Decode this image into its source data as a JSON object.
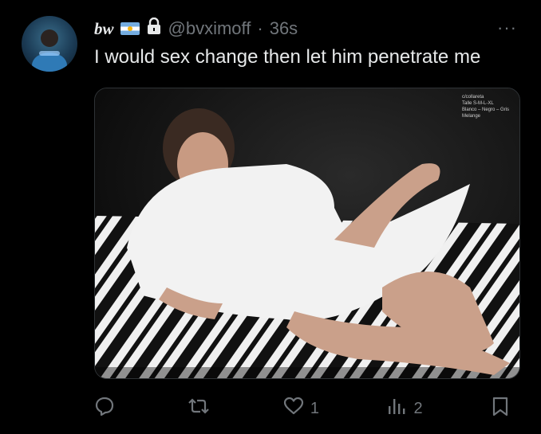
{
  "tweet": {
    "display_name": "bw",
    "handle": "@bvximoff",
    "separator": "·",
    "time": "36s",
    "more": "···",
    "text": "I would sex change then let him penetrate me"
  },
  "media": {
    "label_lines": [
      "c/collareta",
      "Talle S-M-L-XL",
      "Blanco – Negro – Gris",
      "Melange"
    ]
  },
  "actions": {
    "reply": {
      "icon": "reply-icon",
      "count": ""
    },
    "retweet": {
      "icon": "retweet-icon",
      "count": ""
    },
    "like": {
      "icon": "heart-icon",
      "count": "1"
    },
    "views": {
      "icon": "views-icon",
      "count": "2"
    },
    "bookmark": {
      "icon": "bookmark-icon",
      "count": ""
    }
  },
  "colors": {
    "background": "#000000",
    "text": "#e7e9ea",
    "muted": "#71767b",
    "border": "#2f3336"
  }
}
